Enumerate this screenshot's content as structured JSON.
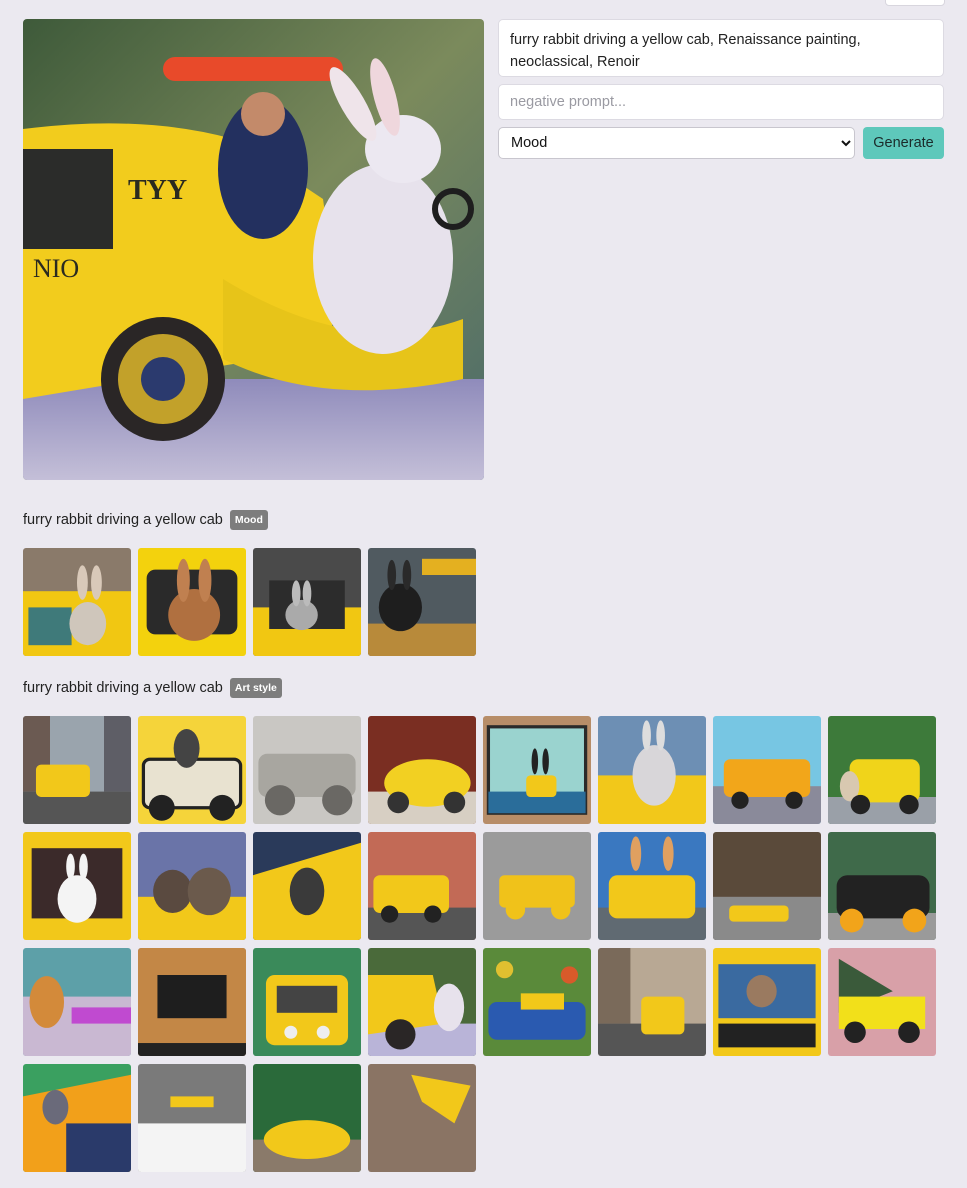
{
  "prompt": {
    "text": "furry rabbit driving a yellow cab, Renaissance painting, neoclassical, Renoir",
    "negative_placeholder": "negative prompt...",
    "negative_value": ""
  },
  "controls": {
    "selected_option": "Mood",
    "generate_label": "Generate"
  },
  "sections": [
    {
      "title": "furry rabbit driving a yellow cab",
      "badge": "Mood"
    },
    {
      "title": "furry rabbit driving a yellow cab",
      "badge": "Art style"
    }
  ],
  "colors": {
    "background": "#ebe9f0",
    "accent": "#5ec8bb",
    "badge": "#7d7d7d",
    "taxi_yellow": "#f2cc1d"
  }
}
